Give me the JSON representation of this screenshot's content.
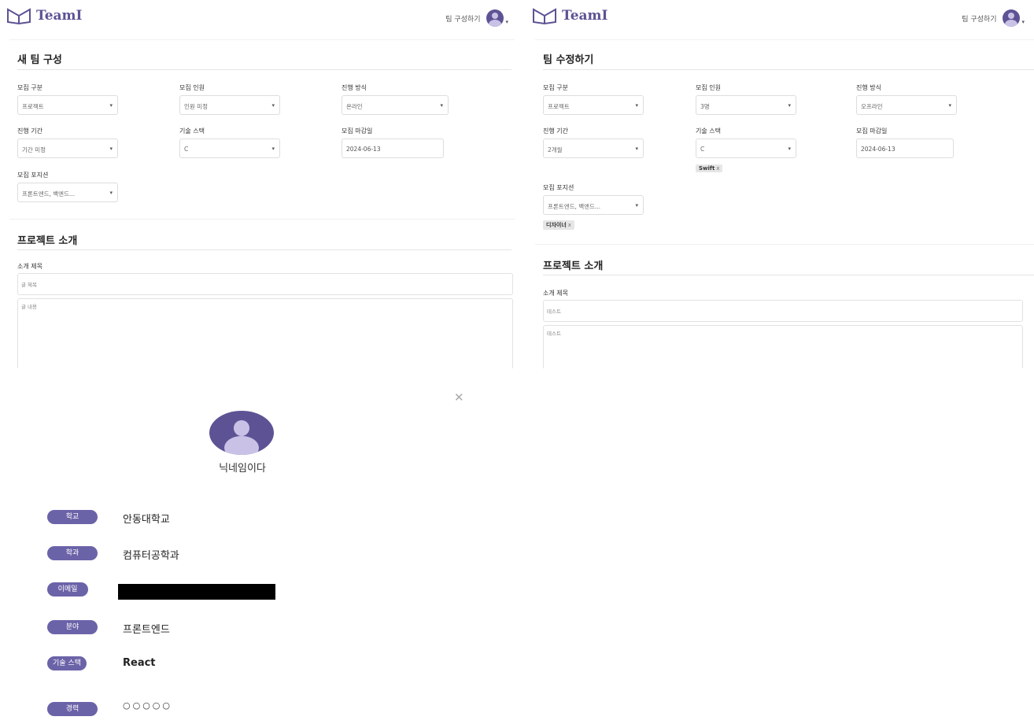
{
  "brand": {
    "name": "TeamI",
    "color": "#5d5394"
  },
  "header": {
    "create_link": "팀 구성하기",
    "avatar_icon": "user-avatar-icon"
  },
  "create_form": {
    "title": "새 팀 구성",
    "fields": [
      {
        "label": "모집 구분",
        "value": "프로젝트"
      },
      {
        "label": "모집 인원",
        "value": "인원 미정"
      },
      {
        "label": "진행 방식",
        "value": "온라인"
      },
      {
        "label": "진행 기간",
        "value": "기간 미정"
      },
      {
        "label": "기술 스택",
        "value": "C"
      },
      {
        "label": "모집 마감일",
        "value": "2024-06-13"
      },
      {
        "label": "모집 포지션",
        "value": "프론트엔드, 백엔드..."
      }
    ],
    "intro": {
      "title": "프로젝트 소개",
      "subject_label": "소개 제목",
      "subject_placeholder": "글 제목",
      "body_placeholder": "글 내용"
    }
  },
  "edit_form": {
    "title": "팀 수정하기",
    "fields": [
      {
        "label": "모집 구분",
        "value": "프로젝트"
      },
      {
        "label": "모집 인원",
        "value": "3명"
      },
      {
        "label": "진행 방식",
        "value": "오프라인"
      },
      {
        "label": "진행 기간",
        "value": "2개월"
      },
      {
        "label": "기술 스택",
        "value": "C",
        "chip": "Swift"
      },
      {
        "label": "모집 마감일",
        "value": "2024-06-13"
      },
      {
        "label": "모집 포지션",
        "value": "프론트엔드, 백엔드...",
        "chip": "디자이너"
      }
    ],
    "intro": {
      "title": "프로젝트 소개",
      "subject_label": "소개 제목",
      "subject_value": "테스트",
      "body_value": "테스트"
    }
  },
  "profile": {
    "nickname": "닉네임이다",
    "rows": [
      {
        "label": "학교",
        "value": "안동대학교"
      },
      {
        "label": "학과",
        "value": "컴퓨터공학과"
      },
      {
        "label": "이메일",
        "value": ""
      },
      {
        "label": "분야",
        "value": "프론트엔드"
      },
      {
        "label": "기술 스택",
        "value": "React"
      },
      {
        "label": "경력",
        "value": "○○○○○"
      }
    ]
  },
  "chip_remove": "x",
  "close_glyph": "✕",
  "dropdown_glyph": "▾"
}
